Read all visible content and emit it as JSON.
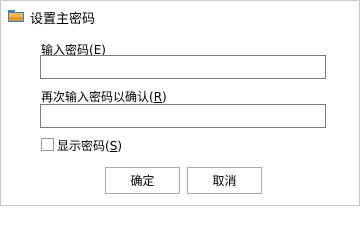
{
  "window": {
    "title": "设置主密码",
    "icon": "app-folder-icon"
  },
  "form": {
    "password_label": "输入密码(",
    "password_mnemonic": "E",
    "password_label_end": ")",
    "password_value": "",
    "confirm_label": "再次输入密码以确认(",
    "confirm_mnemonic": "R",
    "confirm_label_end": ")",
    "confirm_value": "",
    "show_password_label": "显示密码(",
    "show_password_mnemonic": "S",
    "show_password_label_end": ")",
    "show_password_checked": false
  },
  "buttons": {
    "ok_label": "确定",
    "cancel_label": "取消"
  }
}
